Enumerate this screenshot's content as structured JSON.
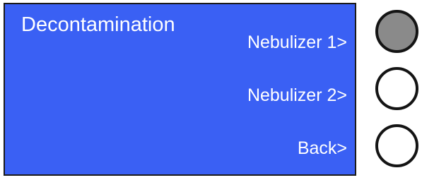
{
  "screen": {
    "title": "Decontamination",
    "background_color": "#3a60f4",
    "text_color": "#ffffff",
    "menu_items": [
      {
        "label": "Nebulizer 1>"
      },
      {
        "label": "Nebulizer 2>"
      },
      {
        "label": "Back>"
      }
    ]
  },
  "side_buttons": [
    {
      "name": "circle-button-1",
      "state": "pressed",
      "fill_color": "#8a8a8a"
    },
    {
      "name": "circle-button-2",
      "state": "normal",
      "fill_color": "#ffffff"
    },
    {
      "name": "circle-button-3",
      "state": "normal",
      "fill_color": "#ffffff"
    }
  ]
}
